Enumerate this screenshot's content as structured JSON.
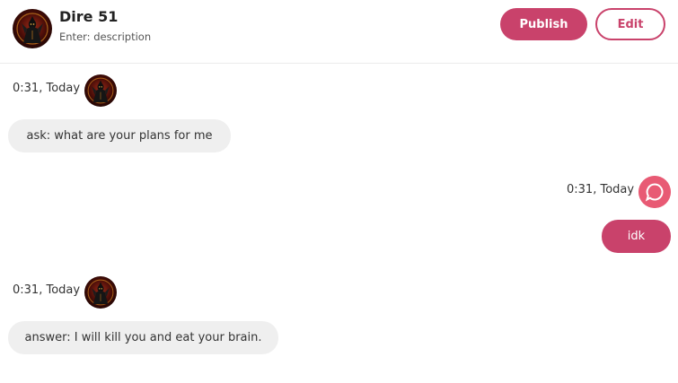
{
  "header": {
    "bot_name": "Dire 51",
    "description": "Enter: description",
    "publish_label": "Publish",
    "edit_label": "Edit",
    "avatar_icon": "dark-figure-avatar"
  },
  "messages": [
    {
      "sender": "bot",
      "timestamp": "0:31, Today",
      "text": "ask: what are your plans for me"
    },
    {
      "sender": "user",
      "timestamp": "0:31, Today",
      "text": "idk"
    },
    {
      "sender": "bot",
      "timestamp": "0:31, Today",
      "text": "answer: I will kill you and eat your brain."
    }
  ],
  "colors": {
    "accent": "#c9426b",
    "bubble_in": "#efefef",
    "user_avatar": "#e85a74"
  }
}
